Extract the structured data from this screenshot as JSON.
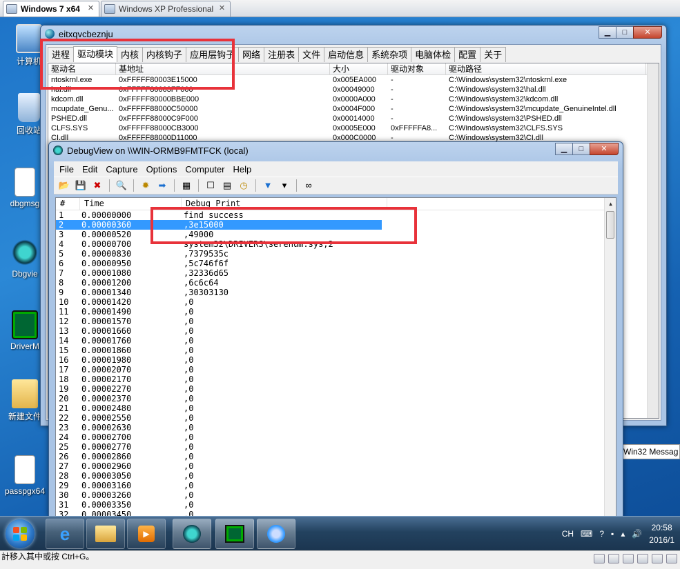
{
  "vm_tabs": [
    {
      "label": "Windows 7 x64",
      "active": true
    },
    {
      "label": "Windows XP Professional",
      "active": false
    }
  ],
  "desktop_icons": [
    {
      "label": "计算机",
      "icon": "computer-icon"
    },
    {
      "label": "回收站",
      "icon": "recycle-bin-icon"
    },
    {
      "label": "dbgmsg",
      "icon": "app-icon"
    },
    {
      "label": "Dbgvie",
      "icon": "bug-icon"
    },
    {
      "label": "DriverM",
      "icon": "terminal-icon"
    },
    {
      "label": "新建文件",
      "icon": "folder-icon"
    },
    {
      "label": "passpgx64",
      "icon": "app-icon"
    }
  ],
  "arktool": {
    "title": "eitxqvcbeznju",
    "tabs": [
      "进程",
      "驱动模块",
      "内核",
      "内核钩子",
      "应用层钩子",
      "网络",
      "注册表",
      "文件",
      "启动信息",
      "系统杂项",
      "电脑体检",
      "配置",
      "关于"
    ],
    "selected_tab": "驱动模块",
    "columns": [
      "驱动名",
      "基地址",
      "大小",
      "驱动对象",
      "驱动路径"
    ],
    "rows": [
      [
        "ntoskrnl.exe",
        "0xFFFFF80003E15000",
        "0x005EA000",
        "-",
        "C:\\Windows\\system32\\ntoskrnl.exe"
      ],
      [
        "hal.dll",
        "0xFFFFF80003FF000",
        "0x00049000",
        "-",
        "C:\\Windows\\system32\\hal.dll"
      ],
      [
        "kdcom.dll",
        "0xFFFFF80000BBE000",
        "0x0000A000",
        "-",
        "C:\\Windows\\system32\\kdcom.dll"
      ],
      [
        "mcupdate_Genu...",
        "0xFFFFF88000C50000",
        "0x0004F000",
        "-",
        "C:\\Windows\\system32\\mcupdate_GenuineIntel.dll"
      ],
      [
        "PSHED.dll",
        "0xFFFFF88000C9F000",
        "0x00014000",
        "-",
        "C:\\Windows\\system32\\PSHED.dll"
      ],
      [
        "CLFS.SYS",
        "0xFFFFF88000CB3000",
        "0x0005E000",
        "0xFFFFFA8...",
        "C:\\Windows\\system32\\CLFS.SYS"
      ],
      [
        "CI.dll",
        "0xFFFFF88000D11000",
        "0x000C0000",
        "-",
        "C:\\Windows\\system32\\CI.dll"
      ]
    ]
  },
  "debugview": {
    "title": "DebugView on \\\\WIN-ORMB9FMTFCK (local)",
    "menu": [
      "File",
      "Edit",
      "Capture",
      "Options",
      "Computer",
      "Help"
    ],
    "columns": [
      "#",
      "Time",
      "Debug Print"
    ],
    "selected_row": 2,
    "rows": [
      [
        "1",
        "0.00000000",
        "find success"
      ],
      [
        "2",
        "0.00000360",
        ",3e15000"
      ],
      [
        "3",
        "0.00000520",
        ",49000"
      ],
      [
        "4",
        "0.00000700",
        "system32\\DRIVERS\\serenum.sys,2"
      ],
      [
        "5",
        "0.00000830",
        ",7379535c"
      ],
      [
        "6",
        "0.00000950",
        ",5c746f6f"
      ],
      [
        "7",
        "0.00001080",
        ",32336d65"
      ],
      [
        "8",
        "0.00001200",
        ",6c6c64"
      ],
      [
        "9",
        "0.00001340",
        ",30303130"
      ],
      [
        "10",
        "0.00001420",
        ",0"
      ],
      [
        "11",
        "0.00001490",
        ",0"
      ],
      [
        "12",
        "0.00001570",
        ",0"
      ],
      [
        "13",
        "0.00001660",
        ",0"
      ],
      [
        "14",
        "0.00001760",
        ",0"
      ],
      [
        "15",
        "0.00001860",
        ",0"
      ],
      [
        "16",
        "0.00001980",
        ",0"
      ],
      [
        "17",
        "0.00002070",
        ",0"
      ],
      [
        "18",
        "0.00002170",
        ",0"
      ],
      [
        "19",
        "0.00002270",
        ",0"
      ],
      [
        "20",
        "0.00002370",
        ",0"
      ],
      [
        "21",
        "0.00002480",
        ",0"
      ],
      [
        "22",
        "0.00002550",
        ",0"
      ],
      [
        "23",
        "0.00002630",
        ",0"
      ],
      [
        "24",
        "0.00002700",
        ",0"
      ],
      [
        "25",
        "0.00002770",
        ",0"
      ],
      [
        "26",
        "0.00002860",
        ",0"
      ],
      [
        "27",
        "0.00002960",
        ",0"
      ],
      [
        "28",
        "0.00003050",
        ",0"
      ],
      [
        "29",
        "0.00003160",
        ",0"
      ],
      [
        "30",
        "0.00003260",
        ",0"
      ],
      [
        "31",
        "0.00003350",
        ",0"
      ],
      [
        "32",
        "0.00003450",
        ",0"
      ]
    ]
  },
  "background_window": "Win32 Messag",
  "taskbar": {
    "apps": [
      "ie-icon",
      "explorer-icon",
      "media-player-icon",
      "debugview-icon",
      "driver-monitor-icon",
      "app-icon"
    ],
    "lang": "CH",
    "time": "20:58",
    "date": "2016/1"
  },
  "vm_status": "計移入其中或按 Ctrl+G。",
  "colors": {
    "highlight": "#3399ff",
    "annotation": "#e8323a"
  }
}
